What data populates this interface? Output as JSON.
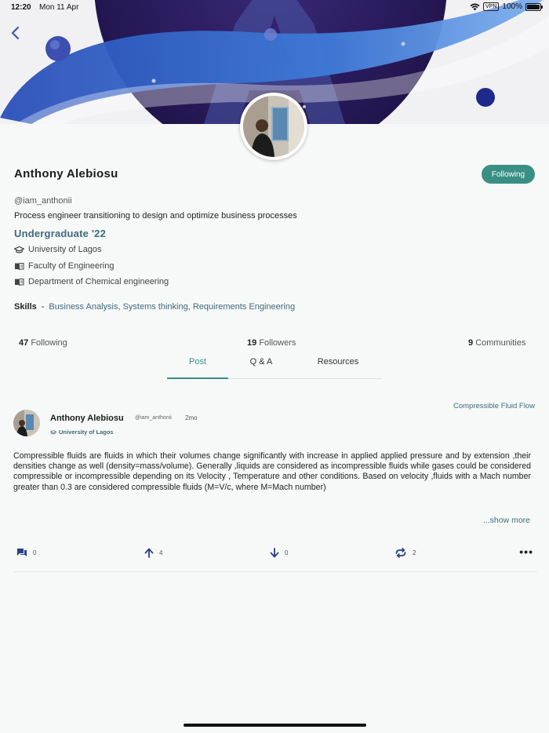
{
  "status_bar": {
    "time": "12:20",
    "date": "Mon 11 Apr",
    "vpn": "VPN",
    "battery": "100%"
  },
  "profile": {
    "name": "Anthony Alebiosu",
    "follow_label": "Following",
    "handle": "@iam_anthonii",
    "bio": "Process engineer transitioning to design and optimize  business processes",
    "year": "Undergraduate '22",
    "university": "University of Lagos",
    "faculty": "Faculty of Engineering",
    "department": "Department of Chemical engineering",
    "skills_label": "Skills",
    "skills_dash": "-",
    "skills": "Business Analysis, Systems thinking, Requirements Engineering"
  },
  "stats": {
    "following_count": "47",
    "following_label": "Following",
    "followers_count": "19",
    "followers_label": "Followers",
    "communities_count": "9",
    "communities_label": "Communities"
  },
  "tabs": [
    {
      "label": "Post",
      "active": true
    },
    {
      "label": "Q & A",
      "active": false
    },
    {
      "label": "Resources",
      "active": false
    }
  ],
  "post": {
    "author": "Anthony Alebiosu",
    "handle": "@iam_anthonii",
    "time": "2mo",
    "university": "University of Lagos",
    "topic": "Compressible Fluid Flow",
    "body": "Compressible fluids are fluids in which their volumes change significantly with increase in applied applied pressure and by extension ,their densities change as well (density=mass/volume). Generally ,liquids are considered as incompressible fluids while gases could be considered compressible or incompressible depending on its Velocity , Temperature and other conditions. Based on velocity ,fluids with a Mach number greater than 0.3 are considered compressible fluids (M=V/c, where M=Mach number)",
    "show_more": "...show more",
    "comments": "0",
    "upvotes": "4",
    "downvotes": "0",
    "reposts": "2",
    "more": "•••"
  },
  "colors": {
    "accent": "#3a8f84",
    "link": "#3e6b7a",
    "banner_planet": "#2a1a5e",
    "banner_ring": "#3d6fd6"
  }
}
